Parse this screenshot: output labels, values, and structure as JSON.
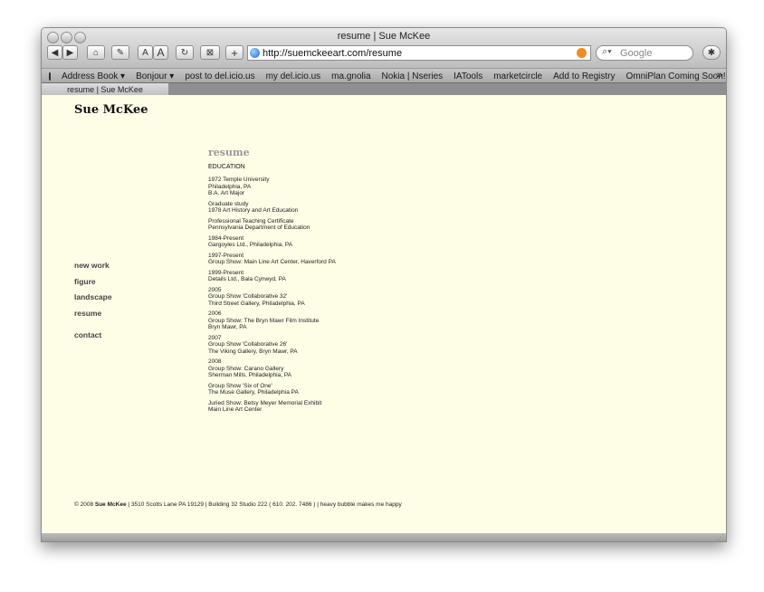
{
  "window": {
    "title": "resume | Sue McKee"
  },
  "toolbar": {
    "text_smaller": "A",
    "text_bigger": "A",
    "add": "+",
    "url": "http://suemckeeart.com/resume",
    "search_placeholder": "Google"
  },
  "bookmarks": [
    "Address Book ▾",
    "Bonjour ▾",
    "post to del.icio.us",
    "my del.icio.us",
    "ma.gnolia",
    "Nokia | Nseries",
    "IATools",
    "marketcircle",
    "Add to Registry",
    "OmniPlan Coming Soon!"
  ],
  "bookmarks_more": "»",
  "tab": {
    "label": "resume | Sue McKee"
  },
  "site": {
    "title": "Sue McKee",
    "nav": [
      "new work",
      "figure",
      "landscape",
      "resume",
      "contact"
    ],
    "section_title": "resume",
    "education_heading": "EDUCATION",
    "entries": [
      [
        "1972 Temple University",
        "Philadelphia, PA",
        "B.A. Art Major"
      ],
      [
        "Graduate study",
        "1978 Art History and Art Education"
      ],
      [
        "Professional Teaching Certificate",
        "Pennsylvania Department of Education"
      ],
      [
        "1984-Present",
        "Gargoyles Ltd., Philadelphia, PA"
      ],
      [
        "1997-Present",
        "Group Show: Main Line Art Center, Haverford PA"
      ],
      [
        "1999-Present",
        "Details Ltd., Bala Cynwyd, PA"
      ],
      [
        "2005",
        "Group Show 'Collaborative 32'",
        "Third Street Gallery, Philadelphia, PA"
      ],
      [
        "2006",
        "Group Show: The Bryn Mawr Film Institute",
        "Bryn Mawr, PA"
      ],
      [
        "2007",
        "Group Show 'Collaborative 26'",
        "The Viking Gallery, Bryn Mawr, PA"
      ],
      [
        "2008",
        "Group Show: Carano Gallery",
        "Sherman Mills, Philadelphia, PA"
      ],
      [
        "Group Show 'Six of One'",
        "The Muse Gallery, Philadelphia PA"
      ],
      [
        "Juried Show: Betsy Meyer Memorial Exhibit",
        "Main Line Art Center"
      ]
    ],
    "footer_prefix": "© 2008",
    "footer_name": "Sue McKee",
    "footer_suffix": "| 3510 Scotts Lane PA 19129 | Building 32 Studio 222 ( 610. 202. 7486 ) | heavy bubble makes me happy"
  }
}
